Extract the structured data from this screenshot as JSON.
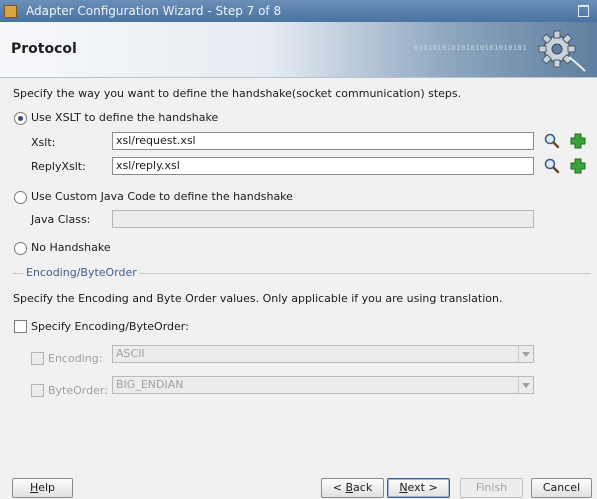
{
  "window": {
    "title": "Adapter Configuration Wizard - Step 7 of 8"
  },
  "header": {
    "page_title": "Protocol",
    "binary_text": "010101010101010101010101"
  },
  "intro": "Specify the way you want to define the handshake(socket communication) steps.",
  "options": {
    "xslt": {
      "label": "Use XSLT to define the handshake",
      "selected": true
    },
    "xslt_fields": {
      "xslt_label": "Xslt:",
      "xslt_value": "xsl/request.xsl",
      "reply_label": "ReplyXslt:",
      "reply_value": "xsl/reply.xsl"
    },
    "custom": {
      "label": "Use Custom Java Code to define the handshake",
      "selected": false
    },
    "java_class_label": "Java Class:",
    "java_class_value": "",
    "none": {
      "label": "No Handshake",
      "selected": false
    }
  },
  "encoding_group": {
    "title": "Encoding/ByteOrder",
    "description": "Specify the Encoding and Byte Order values. Only applicable if you are using translation.",
    "specify_label": "Specify Encoding/ByteOrder:",
    "encoding_label": "Encoding:",
    "encoding_value": "ASCII",
    "byteorder_label": "ByteOrder:",
    "byteorder_value": "BIG_ENDIAN"
  },
  "buttons": {
    "help": {
      "pre": "",
      "mn": "H",
      "post": "elp"
    },
    "back": {
      "pre": "< ",
      "mn": "B",
      "post": "ack"
    },
    "next": {
      "pre": "",
      "mn": "N",
      "post": "ext >"
    },
    "finish": "Finish",
    "cancel": "Cancel"
  },
  "colors": {
    "accent": "#3c5f8e",
    "title_bar": "#4a73a2",
    "add_icon": "#2e9a2e"
  }
}
